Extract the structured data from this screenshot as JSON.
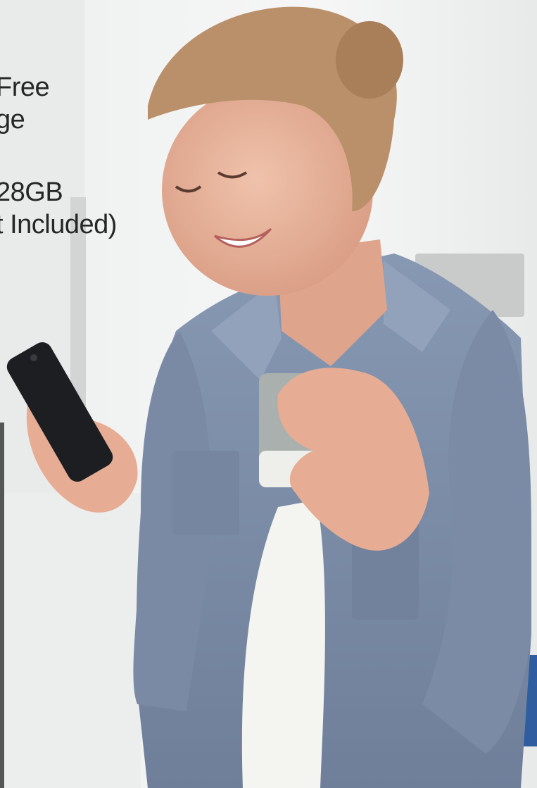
{
  "overlay": {
    "line1": "Free",
    "line2": "ge",
    "line3": "28GB",
    "line4": "t Included)"
  },
  "colors": {
    "background": "#f2f3f3",
    "text": "#262626",
    "shirt": "#7f90ab",
    "hair": "#b9906a",
    "skin": "#e9b49d",
    "phone": "#1d1e22",
    "mug_grey": "#a9b0ad",
    "tee": "#f4f4f1"
  },
  "icons": [
    "smartphone-icon",
    "mug-icon"
  ]
}
